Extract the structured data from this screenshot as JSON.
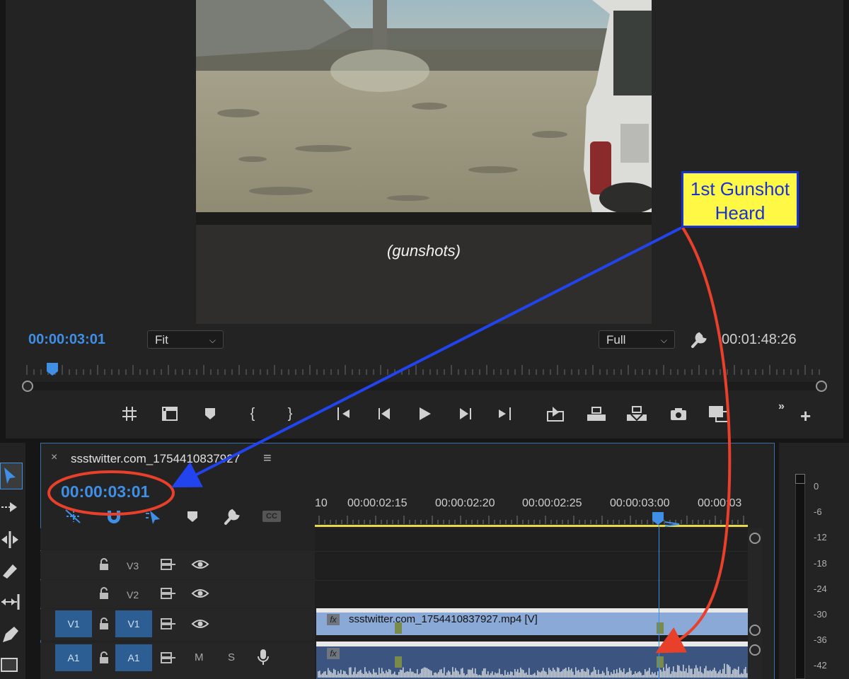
{
  "monitor": {
    "caption": "(gunshots)",
    "playhead_timecode": "00:00:03:01",
    "zoom_select": "Fit",
    "quality_select": "Full",
    "duration_timecode": "00:01:48:26",
    "scrub_progress": 0.02
  },
  "timeline": {
    "sequence_name": "ssstwitter.com_1754410837927",
    "timecode": "00:00:03:01",
    "ruler_ticks": [
      "10",
      "00:00:02:15",
      "00:00:02:20",
      "00:00:02:25",
      "00:00:03:00",
      "00:00:03"
    ],
    "tracks": {
      "v3": "V3",
      "v2": "V2",
      "v1_source": "V1",
      "v1": "V1",
      "a1_source": "A1",
      "a1": "A1",
      "mute": "M",
      "solo": "S"
    },
    "video_clip_name": "ssstwitter.com_1754410837927.mp4 [V]",
    "fx_label": "fx",
    "cc_label": "CC"
  },
  "meter": {
    "labels": [
      "0",
      "-6",
      "-12",
      "-18",
      "-24",
      "-30",
      "-36",
      "-42"
    ]
  },
  "annotation": {
    "line1": "1st Gunshot",
    "line2": "Heard"
  },
  "colors": {
    "accent_blue": "#3f8fe6",
    "annotation_bg": "#fff844",
    "annotation_border": "#1a33cc",
    "arrow_blue": "#2244ee",
    "arrow_red": "#e8402a",
    "video_clip": "#8aa9d6",
    "audio_clip": "#3b5580",
    "work_area": "#e6d84a"
  }
}
